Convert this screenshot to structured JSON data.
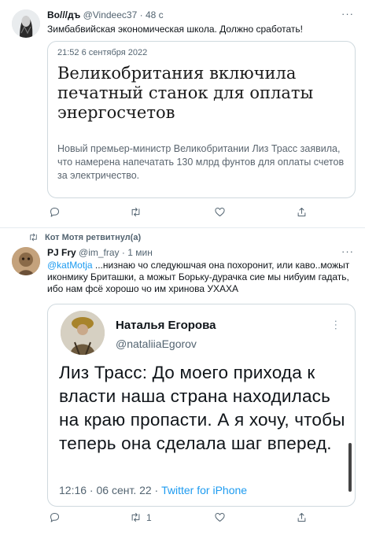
{
  "tweet1": {
    "author_name": "Bo///дъ",
    "author_handle": "@Vindeec37",
    "time": "48 с",
    "text": "Зимбабвийская экономическая школа. Должно сработать!",
    "card": {
      "date": "21:52  6 сентября 2022",
      "headline": "Великобритания включила печатный станок для оплаты энергосчетов",
      "subtitle": "Новый премьер-министр Великобритании Лиз Трасс заявила, что намерена напечатать 130 млрд фунтов для оплаты счетов за электричество."
    }
  },
  "retweet_label": "Кот Мотя ретвитнул(а)",
  "tweet2": {
    "author_name": "PJ Fry",
    "author_handle": "@im_fray",
    "time": "1 мин",
    "mention": "@katMotja",
    "text": " ...низнаю чо следуюшчая она похоронит, или каво..можыт иконмику Бриташки, а можыт Борьку-дурачка сие мы нибуим гадать, ибо нам фсё хорошо чо им хринова УХАХА",
    "quoted": {
      "name": "Наталья Егорова",
      "handle": "@nataliiaEgorov",
      "text": "Лиз Трасс: До моего прихода к власти наша страна находилась на краю пропасти. А я хочу, чтобы теперь она сделала шаг вперед.",
      "timestamp": "12:16 · 06 сент. 22 · ",
      "source": "Twitter for iPhone"
    },
    "retweet_count": "1"
  },
  "separator": "·",
  "more_glyph": "···",
  "colors": {
    "accent": "#1d9bf0",
    "text": "#0f1419",
    "muted": "#536471",
    "border": "#cfd9de"
  },
  "icons": [
    "reply-icon",
    "retweet-icon",
    "like-icon",
    "share-icon",
    "more-icon"
  ]
}
